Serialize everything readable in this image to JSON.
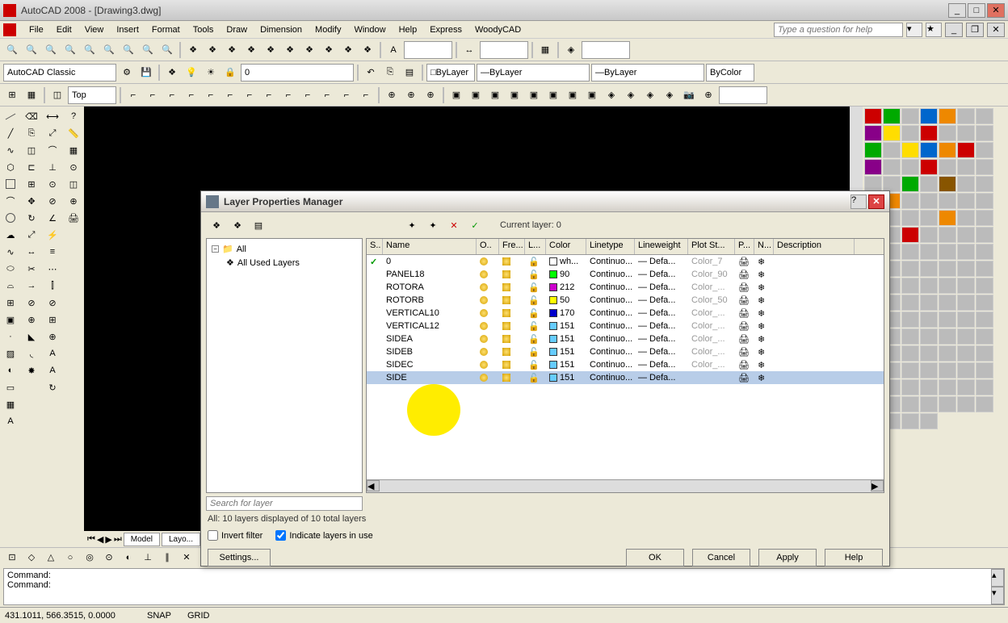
{
  "titlebar": {
    "text": "AutoCAD 2008 - [Drawing3.dwg]"
  },
  "menu": {
    "items": [
      "File",
      "Edit",
      "View",
      "Insert",
      "Format",
      "Tools",
      "Draw",
      "Dimension",
      "Modify",
      "Window",
      "Help",
      "Express",
      "WoodyCAD"
    ],
    "help_placeholder": "Type a question for help"
  },
  "workspace_combo": "AutoCAD Classic",
  "layer_combo": "0",
  "prop_combos": {
    "color": "ByLayer",
    "linetype": "ByLayer",
    "lineweight": "ByLayer",
    "plotstyle": "ByColor"
  },
  "view_combo": "Top",
  "dialog": {
    "title": "Layer Properties Manager",
    "current_layer_label": "Current layer: 0",
    "tree": {
      "root": "All",
      "child": "All Used Layers"
    },
    "columns": [
      "S..",
      "Name",
      "O..",
      "Fre...",
      "L...",
      "Color",
      "Linetype",
      "Lineweight",
      "Plot St...",
      "P...",
      "N...",
      "Description"
    ],
    "rows": [
      {
        "status": "✓",
        "name": "0",
        "color_swatch": "#ffffff",
        "color": "wh...",
        "linetype": "Continuo...",
        "lineweight": "Defa...",
        "plot": "Color_7"
      },
      {
        "status": "",
        "name": "PANEL18",
        "color_swatch": "#00ff00",
        "color": "90",
        "linetype": "Continuo...",
        "lineweight": "Defa...",
        "plot": "Color_90"
      },
      {
        "status": "",
        "name": "ROTORA",
        "color_swatch": "#cc00cc",
        "color": "212",
        "linetype": "Continuo...",
        "lineweight": "Defa...",
        "plot": "Color_..."
      },
      {
        "status": "",
        "name": "ROTORB",
        "color_swatch": "#ffff00",
        "color": "50",
        "linetype": "Continuo...",
        "lineweight": "Defa...",
        "plot": "Color_50"
      },
      {
        "status": "",
        "name": "VERTICAL10",
        "color_swatch": "#0000cc",
        "color": "170",
        "linetype": "Continuo...",
        "lineweight": "Defa...",
        "plot": "Color_..."
      },
      {
        "status": "",
        "name": "VERTICAL12",
        "color_swatch": "#66ccff",
        "color": "151",
        "linetype": "Continuo...",
        "lineweight": "Defa...",
        "plot": "Color_..."
      },
      {
        "status": "",
        "name": "SIDEA",
        "color_swatch": "#66ccff",
        "color": "151",
        "linetype": "Continuo...",
        "lineweight": "Defa...",
        "plot": "Color_..."
      },
      {
        "status": "",
        "name": "SIDEB",
        "color_swatch": "#66ccff",
        "color": "151",
        "linetype": "Continuo...",
        "lineweight": "Defa...",
        "plot": "Color_..."
      },
      {
        "status": "",
        "name": "SIDEC",
        "color_swatch": "#66ccff",
        "color": "151",
        "linetype": "Continuo...",
        "lineweight": "Defa...",
        "plot": "Color_..."
      },
      {
        "status": "",
        "name": "SIDE",
        "color_swatch": "#66ccff",
        "color": "151",
        "linetype": "Continuo...",
        "lineweight": "Defa...",
        "plot": "",
        "selected": true
      }
    ],
    "search_placeholder": "Search for layer",
    "status_line": "All: 10 layers displayed of 10 total layers",
    "invert_label": "Invert filter",
    "indicate_label": "Indicate layers in use",
    "settings_btn": "Settings...",
    "ok": "OK",
    "cancel": "Cancel",
    "apply": "Apply",
    "help": "Help"
  },
  "canvas_tabs": [
    "Model",
    "Layo..."
  ],
  "command": {
    "line1": "Command:",
    "line2": "Command:"
  },
  "status": {
    "coords": "431.1011, 566.3515, 0.0000",
    "toggles": [
      "SNAP",
      "GRID"
    ]
  }
}
